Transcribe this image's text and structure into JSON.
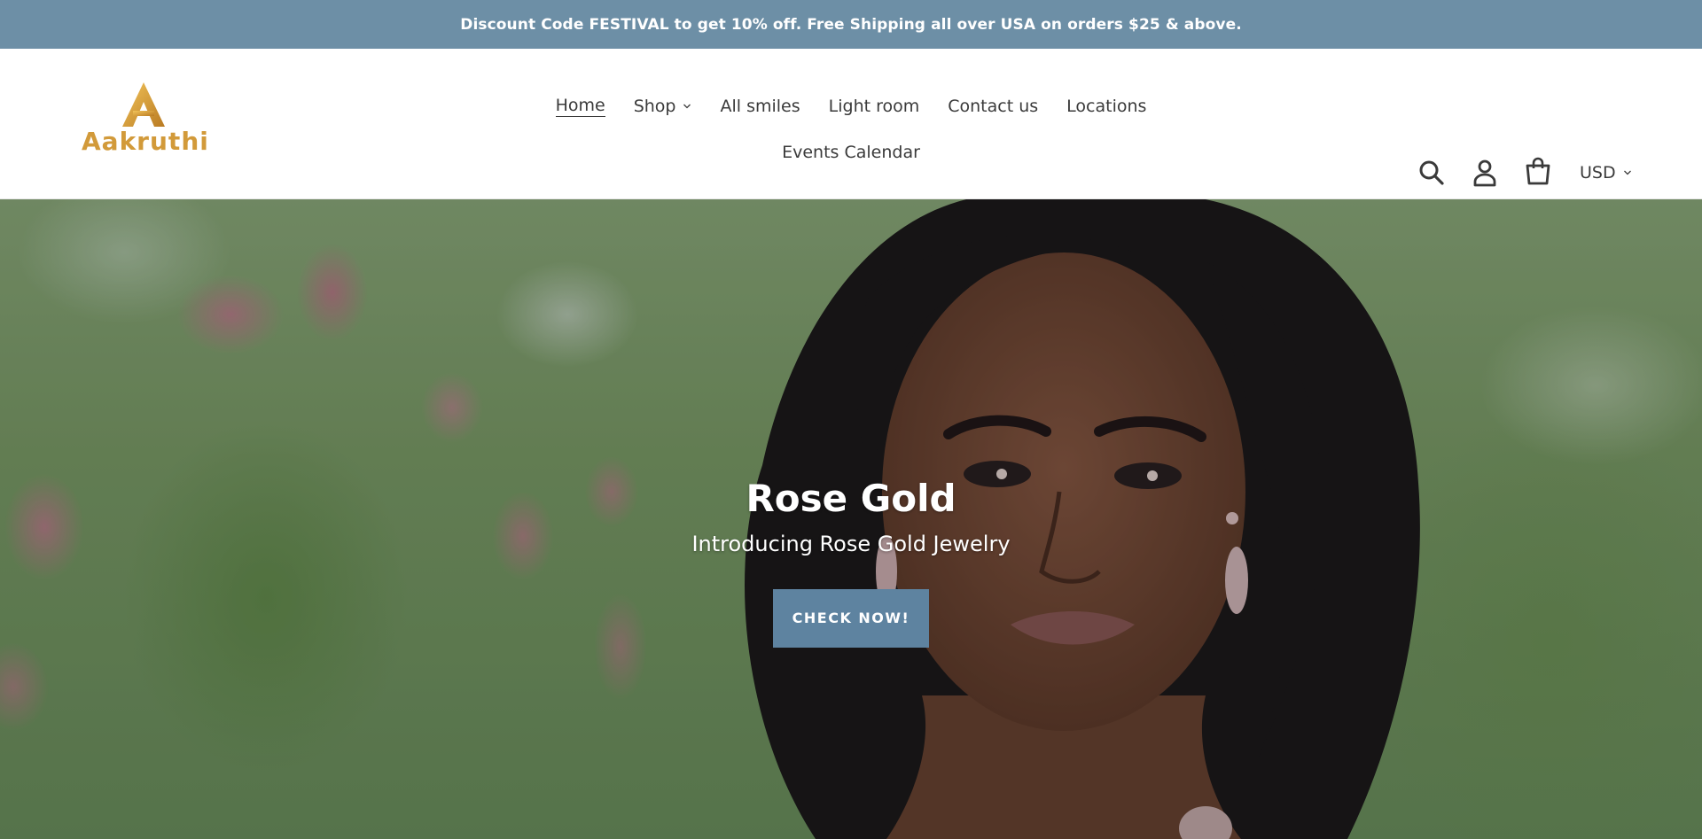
{
  "announcement": "Discount Code FESTIVAL to get 10% off. Free Shipping all over USA on orders $25 & above.",
  "logo": {
    "text": "Aakruthi"
  },
  "nav": {
    "items": [
      {
        "label": "Home",
        "active": true
      },
      {
        "label": "Shop",
        "dropdown": true
      },
      {
        "label": "All smiles"
      },
      {
        "label": "Light room"
      },
      {
        "label": "Contact us"
      },
      {
        "label": "Locations"
      },
      {
        "label": "Events Calendar"
      }
    ]
  },
  "header_icons": [
    "search-icon",
    "account-icon",
    "cart-icon"
  ],
  "currency": {
    "selected": "USD"
  },
  "hero": {
    "title": "Rose Gold",
    "subtitle": "Introducing Rose Gold Jewelry",
    "button": "CHECK NOW!"
  },
  "colors": {
    "announcement_bg": "#6d8fa6",
    "button_bg": "#5e83a0",
    "logo_gold": "#d29a3a",
    "text": "#3a3a3a"
  }
}
